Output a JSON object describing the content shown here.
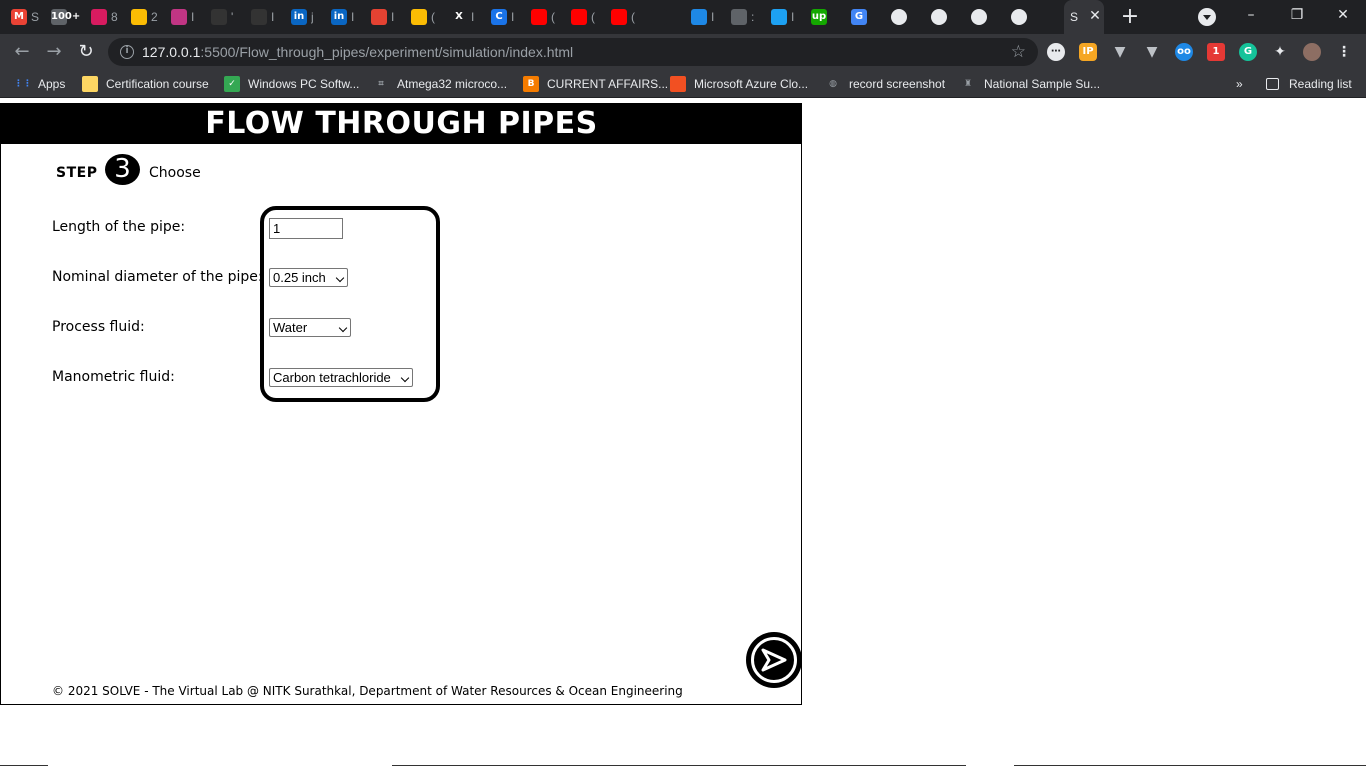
{
  "browser": {
    "tabs": [
      {
        "label": "M",
        "title": "S",
        "color": "#ea4335",
        "icon": "gmail-icon"
      },
      {
        "label": "100+",
        "title": "",
        "color": "#5f6368",
        "icon": "gmail-icon"
      },
      {
        "label": "",
        "title": "8",
        "color": "#d81b60",
        "icon": "contacts-icon"
      },
      {
        "label": "",
        "title": "2",
        "color": "#fbbc04",
        "icon": "drive-icon"
      },
      {
        "label": "",
        "title": "I",
        "color": "#c13584",
        "icon": "instagram-icon"
      },
      {
        "label": "",
        "title": "'",
        "color": "#333333",
        "icon": "github-icon"
      },
      {
        "label": "",
        "title": "I",
        "color": "#333333",
        "icon": "github-icon"
      },
      {
        "label": "in",
        "title": "j",
        "color": "#0a66c2",
        "icon": "linkedin-icon"
      },
      {
        "label": "in",
        "title": "I",
        "color": "#0a66c2",
        "icon": "linkedin-icon"
      },
      {
        "label": "",
        "title": "I",
        "color": "#e44232",
        "icon": "todoist-icon"
      },
      {
        "label": "",
        "title": "(",
        "color": "#fbbc04",
        "icon": "keep-icon"
      },
      {
        "label": "X",
        "title": "I",
        "color": "#202124",
        "icon": "x-icon"
      },
      {
        "label": "C",
        "title": "I",
        "color": "#1a73e8",
        "icon": "c-icon"
      },
      {
        "label": "",
        "title": "(",
        "color": "#ff0000",
        "icon": "youtube-icon"
      },
      {
        "label": "",
        "title": "(",
        "color": "#ff0000",
        "icon": "youtube-icon"
      },
      {
        "label": "",
        "title": "(",
        "color": "#ff0000",
        "icon": "youtube-icon"
      },
      {
        "label": "",
        "title": "",
        "color": "#202124",
        "icon": "blank-icon"
      },
      {
        "label": "",
        "title": "I",
        "color": "#1e88e5",
        "icon": "photo-icon"
      },
      {
        "label": "",
        "title": ":",
        "color": "#5f6368",
        "icon": "peace-icon"
      },
      {
        "label": "",
        "title": "I",
        "color": "#1da1f2",
        "icon": "y-icon"
      },
      {
        "label": "up",
        "title": "",
        "color": "#14a800",
        "icon": "upwork-icon"
      },
      {
        "label": "G",
        "title": "",
        "color": "#4285f4",
        "icon": "google-icon"
      },
      {
        "label": "",
        "title": "",
        "color": "#e8eaed",
        "icon": "globe-icon"
      },
      {
        "label": "",
        "title": "",
        "color": "#e8eaed",
        "icon": "globe-icon"
      },
      {
        "label": "",
        "title": "",
        "color": "#e8eaed",
        "icon": "globe-icon"
      },
      {
        "label": "",
        "title": "",
        "color": "#e8eaed",
        "icon": "globe-icon"
      }
    ],
    "active_tab_title": "S",
    "url_host": "127.0.0.1",
    "url_path": ":5500/Flow_through_pipes/experiment/simulation/index.html",
    "bookmarks": [
      {
        "label": "Apps",
        "icon": "apps-grid-icon",
        "color": "#4285f4"
      },
      {
        "label": "Certification course",
        "icon": "folder-icon",
        "color": "#fdd663"
      },
      {
        "label": "Windows PC Softw...",
        "icon": "softpedia-icon",
        "color": "#34a853"
      },
      {
        "label": "Atmega32 microco...",
        "icon": "chip-icon",
        "color": "#9aa0a6"
      },
      {
        "label": "CURRENT AFFAIRS...",
        "icon": "blogger-icon",
        "color": "#f57c00"
      },
      {
        "label": "Microsoft Azure Clo...",
        "icon": "microsoft-icon",
        "color": "#f25022"
      },
      {
        "label": "record screenshot",
        "icon": "globe-icon",
        "color": "#9aa0a6"
      },
      {
        "label": "National Sample Su...",
        "icon": "emblem-icon",
        "color": "#9aa0a6"
      }
    ],
    "more_bookmarks": "»",
    "reading_list": "Reading list"
  },
  "page": {
    "header_title": "FLOW THROUGH PIPES",
    "step_label": "STEP",
    "step_number": "3",
    "step_title": "Choose",
    "fields": {
      "length_label": "Length of the pipe:",
      "length_value": "1",
      "diameter_label": "Nominal diameter of the pipe:",
      "diameter_value": "0.25 inch",
      "process_label": "Process fluid:",
      "process_value": "Water",
      "manometric_label": "Manometric fluid:",
      "manometric_value": "Carbon tetrachloride"
    },
    "footer": "© 2021 SOLVE - The Virtual Lab @ NITK Surathkal, Department of Water Resources & Ocean Engineering"
  }
}
